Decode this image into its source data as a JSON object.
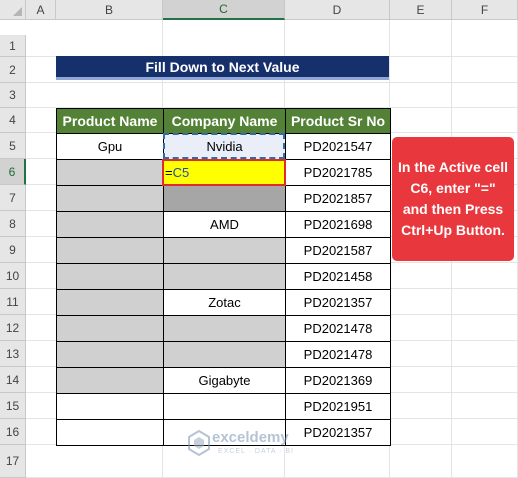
{
  "columns": [
    "A",
    "B",
    "C",
    "D",
    "E",
    "F"
  ],
  "rows": [
    "1",
    "2",
    "3",
    "4",
    "5",
    "6",
    "7",
    "8",
    "9",
    "10",
    "11",
    "12",
    "13",
    "14",
    "15",
    "16",
    "17"
  ],
  "title": "Fill Down to Next Value",
  "table": {
    "headers": [
      "Product Name",
      "Company  Name",
      "Product Sr No"
    ],
    "rows": [
      {
        "b": "Gpu",
        "c": "Nvidia",
        "d": "PD2021547",
        "b_state": "white",
        "c_state": "copy"
      },
      {
        "b": "",
        "c": "",
        "d": "PD2021785",
        "b_state": "gray",
        "c_state": "active"
      },
      {
        "b": "",
        "c": "",
        "d": "PD2021857",
        "b_state": "gray",
        "c_state": "dark"
      },
      {
        "b": "",
        "c": "AMD",
        "d": "PD2021698",
        "b_state": "gray",
        "c_state": "white"
      },
      {
        "b": "",
        "c": "",
        "d": "PD2021587",
        "b_state": "gray",
        "c_state": "gray"
      },
      {
        "b": "",
        "c": "",
        "d": "PD2021458",
        "b_state": "gray",
        "c_state": "gray"
      },
      {
        "b": "",
        "c": "Zotac",
        "d": "PD2021357",
        "b_state": "gray",
        "c_state": "white"
      },
      {
        "b": "",
        "c": "",
        "d": "PD2021478",
        "b_state": "gray",
        "c_state": "gray"
      },
      {
        "b": "",
        "c": "",
        "d": "PD2021478",
        "b_state": "gray",
        "c_state": "gray"
      },
      {
        "b": "",
        "c": "Gigabyte",
        "d": "PD2021369",
        "b_state": "gray",
        "c_state": "white"
      },
      {
        "b": "",
        "c": "",
        "d": "PD2021951",
        "b_state": "white",
        "c_state": "white"
      },
      {
        "b": "",
        "c": "",
        "d": "PD2021357",
        "b_state": "white",
        "c_state": "white"
      }
    ]
  },
  "active_cell": {
    "eq": "=",
    "ref": "C5"
  },
  "callout": "In the Active cell C6, enter \"=\" and then Press Ctrl+Up Button.",
  "watermark": {
    "name": "exceldemy",
    "sub": "EXCEL · DATA · BI"
  },
  "colors": {
    "header_green": "#538135",
    "title_navy": "#16306b",
    "callout_red": "#e8383d",
    "active_yellow": "#ffff00"
  }
}
